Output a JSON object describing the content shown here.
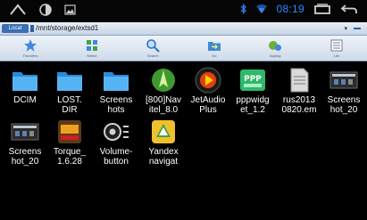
{
  "status_bar": {
    "time": "08:19",
    "icons": [
      "home-icon",
      "notification-icon",
      "image-icon",
      "bluetooth-icon",
      "wifi-icon",
      "recent-apps-icon",
      "back-icon"
    ]
  },
  "address_bar": {
    "location_chip": "Local",
    "path": "/mnt/storage/extsd1"
  },
  "toolbar": {
    "items": [
      {
        "label": "Favorites",
        "icon": "star-icon"
      },
      {
        "label": "Select",
        "icon": "select-icon"
      },
      {
        "label": "Search",
        "icon": "search-icon"
      },
      {
        "label": "Go",
        "icon": "folder-go-icon"
      },
      {
        "label": "Applog",
        "icon": "applog-icon"
      },
      {
        "label": "List",
        "icon": "list-icon"
      }
    ]
  },
  "files": [
    {
      "label": "DCIM",
      "icon": "folder-icon"
    },
    {
      "label": "LOST.\nDIR",
      "icon": "folder-icon"
    },
    {
      "label": "Screens\nhots",
      "icon": "folder-icon"
    },
    {
      "label": "[800]Nav\nitel_8.0",
      "icon": "navitel-app-icon"
    },
    {
      "label": "JetAudio\nPlus",
      "icon": "jetaudio-app-icon"
    },
    {
      "label": "pppwidg\net_1.2",
      "icon": "ppp-widget-app-icon"
    },
    {
      "label": "rus2013\n0820.em",
      "icon": "document-file-icon"
    },
    {
      "label": "Screens\nhot_20",
      "icon": "screenshot-image-icon"
    },
    {
      "label": "Screens\nhot_20",
      "icon": "screenshot-image-icon"
    },
    {
      "label": "Torque_\n1.6.28",
      "icon": "torque-app-icon"
    },
    {
      "label": "Volume-\nbutton",
      "icon": "volume-button-app-icon"
    },
    {
      "label": "Yandex\nnavigat",
      "icon": "yandex-navigator-app-icon"
    }
  ]
}
